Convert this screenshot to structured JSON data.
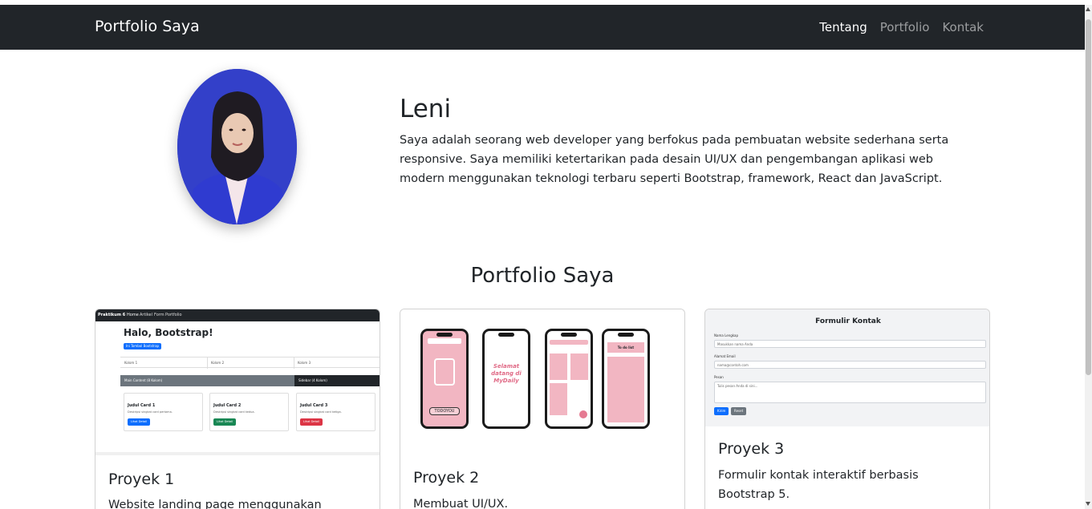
{
  "navbar": {
    "brand": "Portfolio Saya",
    "links": [
      "Tentang",
      "Portfolio",
      "Kontak"
    ],
    "active": "Tentang"
  },
  "about": {
    "name": "Leni",
    "description": "Saya adalah seorang web developer yang berfokus pada pembuatan website sederhana serta responsive. Saya memiliki ketertarikan pada desain UI/UX dan pengembangan aplikasi web modern menggunakan teknologi terbaru seperti Bootstrap, framework, React dan JavaScript."
  },
  "portfolio": {
    "title": "Portfolio Saya",
    "projects": [
      {
        "title": "Proyek 1",
        "description": "Website landing page menggunakan",
        "thumb": {
          "nav_brand": "Praktikum 6",
          "nav_links": [
            "Home",
            "Artikel",
            "Form",
            "Portfolio"
          ],
          "heading": "Halo, Bootstrap!",
          "cta": "Ini Tombol Bootstrap",
          "cols": [
            "Kolom 1",
            "Kolom 2",
            "Kolom 3"
          ],
          "main": "Main Content (8 Kolom)",
          "side": "Sidebar (4 Kolom)",
          "cards": [
            {
              "title": "Judul Card 1",
              "text": "Deskripsi singkat card pertama.",
              "button": "Lihat Detail"
            },
            {
              "title": "Judul Card 2",
              "text": "Deskripsi singkat card kedua.",
              "button": "Lihat Detail"
            },
            {
              "title": "Judul Card 3",
              "text": "Deskripsi singkat card ketiga.",
              "button": "Lihat Detail"
            }
          ]
        }
      },
      {
        "title": "Proyek 2",
        "description": "Membuat UI/UX.",
        "thumb": {
          "app_name": "To do list",
          "welcome": "Selamat datang di MyDaily",
          "logo_text": "TODOYOU"
        }
      },
      {
        "title": "Proyek 3",
        "description": "Formulir kontak interaktif berbasis Bootstrap 5.",
        "thumb": {
          "title": "Formulir Kontak",
          "name_label": "Nama Lengkap",
          "name_placeholder": "Masukkan nama Anda",
          "email_label": "Alamat Email",
          "email_placeholder": "nama@contoh.com",
          "message_label": "Pesan",
          "message_placeholder": "Tulis pesan Anda di sini...",
          "submit": "Kirim",
          "reset": "Reset"
        }
      }
    ]
  },
  "colors": {
    "navbar_bg": "#212529",
    "primary": "#0d6efd",
    "success": "#198754",
    "danger": "#dc3545",
    "pink": "#f2b6c2"
  }
}
